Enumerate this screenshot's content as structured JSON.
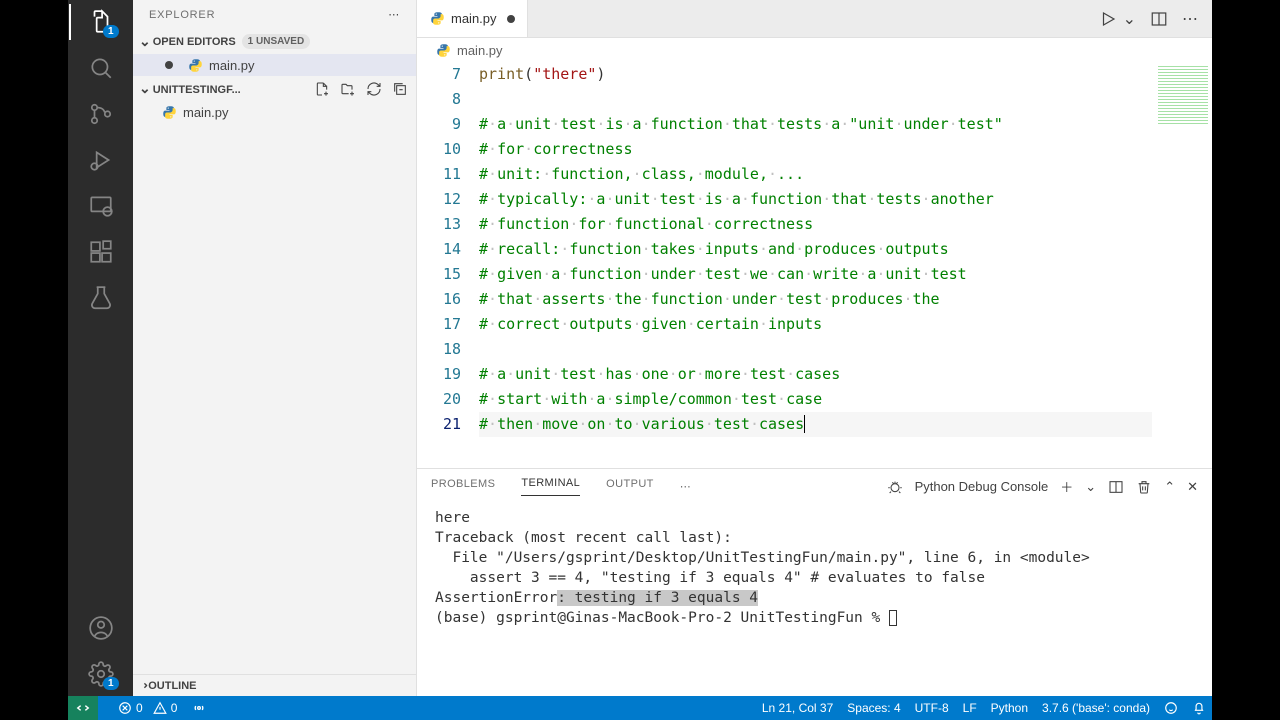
{
  "sidebar": {
    "title": "EXPLORER",
    "openEditorsLabel": "OPEN EDITORS",
    "unsavedBadge": "1 UNSAVED",
    "folderName": "UNITTESTINGF...",
    "openFile": "main.py",
    "treeFile": "main.py",
    "outlineLabel": "OUTLINE"
  },
  "tab": {
    "label": "main.py"
  },
  "breadcrumb": {
    "file": "main.py"
  },
  "activityBadge": "1",
  "settingsBadge": "1",
  "code": {
    "lines": [
      {
        "n": 7,
        "type": "code",
        "fn": "print",
        "paren1": "(",
        "str": "\"there\"",
        "paren2": ")"
      },
      {
        "n": 8,
        "type": "blank"
      },
      {
        "n": 9,
        "type": "cmt",
        "t": "# a unit test is a function that tests a \"unit under test\""
      },
      {
        "n": 10,
        "type": "cmt",
        "t": "# for correctness"
      },
      {
        "n": 11,
        "type": "cmt",
        "t": "# unit: function, class, module, ..."
      },
      {
        "n": 12,
        "type": "cmt",
        "t": "# typically: a unit test is a function that tests another"
      },
      {
        "n": 13,
        "type": "cmt",
        "t": "# function for functional correctness"
      },
      {
        "n": 14,
        "type": "cmt",
        "t": "# recall: function takes inputs and produces outputs"
      },
      {
        "n": 15,
        "type": "cmt",
        "t": "# given a function under test we can write a unit test"
      },
      {
        "n": 16,
        "type": "cmt",
        "t": "# that asserts the function under test produces the"
      },
      {
        "n": 17,
        "type": "cmt",
        "t": "# correct outputs given certain inputs"
      },
      {
        "n": 18,
        "type": "blank"
      },
      {
        "n": 19,
        "type": "cmt",
        "t": "# a unit test has one or more test cases"
      },
      {
        "n": 20,
        "type": "cmt",
        "t": "# start with a simple/common test case"
      },
      {
        "n": 21,
        "type": "cmt",
        "t": "# then move on to various test cases",
        "current": true
      }
    ]
  },
  "panel": {
    "tabs": {
      "problems": "PROBLEMS",
      "terminal": "TERMINAL",
      "output": "OUTPUT"
    },
    "consoleLabel": "Python Debug Console",
    "terminalLines": [
      "here",
      "Traceback (most recent call last):",
      "  File \"/Users/gsprint/Desktop/UnitTestingFun/main.py\", line 6, in <module>",
      "    assert 3 == 4, \"testing if 3 equals 4\" # evaluates to false",
      "AssertionError",
      ": testing if 3 equals 4",
      "(base) gsprint@Ginas-MacBook-Pro-2 UnitTestingFun % "
    ]
  },
  "status": {
    "errors": "0",
    "warnings": "0",
    "lncol": "Ln 21, Col 37",
    "spaces": "Spaces: 4",
    "encoding": "UTF-8",
    "eol": "LF",
    "lang": "Python",
    "interp": "3.7.6 ('base': conda)"
  }
}
